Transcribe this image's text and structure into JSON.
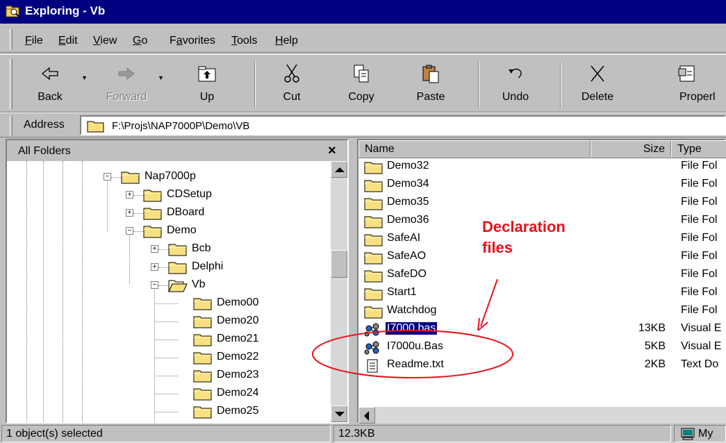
{
  "window": {
    "title": "Exploring - Vb"
  },
  "menu": [
    "File",
    "Edit",
    "View",
    "Go",
    "Favorites",
    "Tools",
    "Help"
  ],
  "menu_underline": [
    "F",
    "E",
    "V",
    "G",
    "a",
    "T",
    "H"
  ],
  "toolbar": {
    "back": "Back",
    "forward": "Forward",
    "up": "Up",
    "cut": "Cut",
    "copy": "Copy",
    "paste": "Paste",
    "undo": "Undo",
    "delete": "Delete",
    "properties": "Properl"
  },
  "address": {
    "label": "Address",
    "value": "F:\\Projs\\NAP7000P\\Demo\\VB"
  },
  "left_pane": {
    "title": "All Folders",
    "close": "×",
    "tree": [
      "Nap7000p",
      "CDSetup",
      "DBoard",
      "Demo",
      "Bcb",
      "Delphi",
      "Vb",
      "Demo00",
      "Demo20",
      "Demo21",
      "Demo22",
      "Demo23",
      "Demo24",
      "Demo25"
    ]
  },
  "right_pane": {
    "columns": {
      "name": "Name",
      "size": "Size",
      "type": "Type"
    },
    "files": [
      {
        "name": "Demo32",
        "size": "",
        "type": "File Fol",
        "icon": "folder"
      },
      {
        "name": "Demo34",
        "size": "",
        "type": "File Fol",
        "icon": "folder"
      },
      {
        "name": "Demo35",
        "size": "",
        "type": "File Fol",
        "icon": "folder"
      },
      {
        "name": "Demo36",
        "size": "",
        "type": "File Fol",
        "icon": "folder"
      },
      {
        "name": "SafeAI",
        "size": "",
        "type": "File Fol",
        "icon": "folder"
      },
      {
        "name": "SafeAO",
        "size": "",
        "type": "File Fol",
        "icon": "folder"
      },
      {
        "name": "SafeDO",
        "size": "",
        "type": "File Fol",
        "icon": "folder"
      },
      {
        "name": "Start1",
        "size": "",
        "type": "File Fol",
        "icon": "folder"
      },
      {
        "name": "Watchdog",
        "size": "",
        "type": "File Fol",
        "icon": "folder"
      },
      {
        "name": "I7000.bas",
        "size": "13KB",
        "type": "Visual E",
        "icon": "vb-module",
        "selected": true
      },
      {
        "name": "I7000u.Bas",
        "size": "5KB",
        "type": "Visual E",
        "icon": "vb-module"
      },
      {
        "name": "Readme.txt",
        "size": "2KB",
        "type": "Text Do",
        "icon": "text-file"
      }
    ]
  },
  "annotation": {
    "line1": "Declaration",
    "line2": "files",
    "color": "#e8121b"
  },
  "status": {
    "selected": "1 object(s) selected",
    "size": "12.3KB",
    "location": "My"
  }
}
